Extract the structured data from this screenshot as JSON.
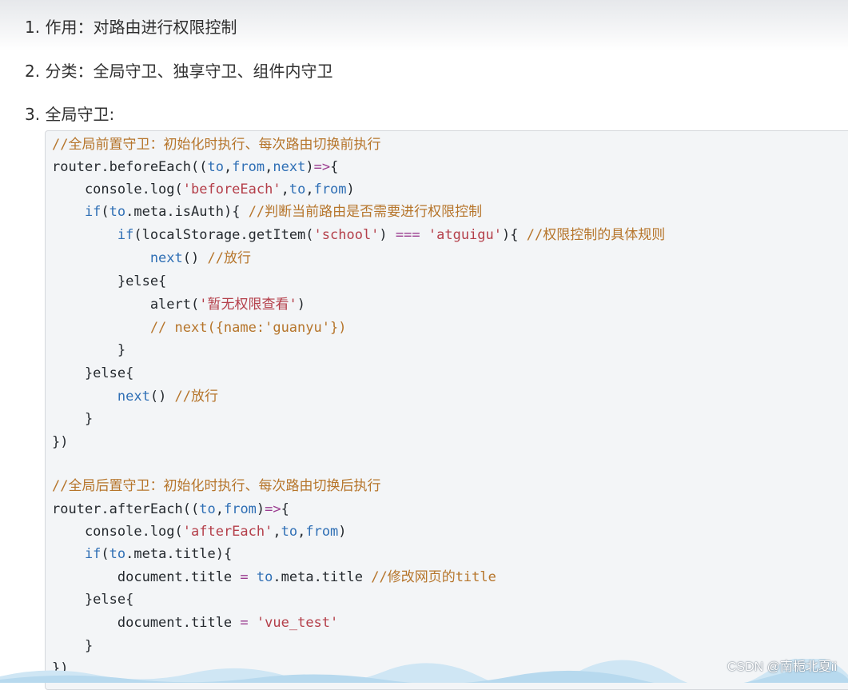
{
  "list": [
    {
      "label": "1. 作用：对路由进行权限控制"
    },
    {
      "label": "2. 分类：全局守卫、独享守卫、组件内守卫"
    },
    {
      "label": "3. 全局守卫:"
    }
  ],
  "code": [
    [
      [
        "c",
        "//全局前置守卫：初始化时执行、每次路由切换前执行"
      ]
    ],
    [
      [
        "i",
        "router.beforeEach(("
      ],
      [
        "k",
        "to"
      ],
      [
        "i",
        ","
      ],
      [
        "k",
        "from"
      ],
      [
        "i",
        ","
      ],
      [
        "k",
        "next"
      ],
      [
        "i",
        ")"
      ],
      [
        "o",
        "=>"
      ],
      [
        "i",
        "{"
      ]
    ],
    [
      [
        "i",
        "    console.log("
      ],
      [
        "s",
        "'beforeEach'"
      ],
      [
        "i",
        ","
      ],
      [
        "k",
        "to"
      ],
      [
        "i",
        ","
      ],
      [
        "k",
        "from"
      ],
      [
        "i",
        ")"
      ]
    ],
    [
      [
        "k",
        "    if"
      ],
      [
        "i",
        "("
      ],
      [
        "k",
        "to"
      ],
      [
        "i",
        ".meta.isAuth){ "
      ],
      [
        "c",
        "//判断当前路由是否需要进行权限控制"
      ]
    ],
    [
      [
        "k",
        "        if"
      ],
      [
        "i",
        "(localStorage.getItem("
      ],
      [
        "s",
        "'school'"
      ],
      [
        "i",
        ") "
      ],
      [
        "o",
        "==="
      ],
      [
        "i",
        " "
      ],
      [
        "s",
        "'atguigu'"
      ],
      [
        "i",
        "){ "
      ],
      [
        "c",
        "//权限控制的具体规则"
      ]
    ],
    [
      [
        "k",
        "            next"
      ],
      [
        "i",
        "() "
      ],
      [
        "c",
        "//放行"
      ]
    ],
    [
      [
        "i",
        "        }else{"
      ]
    ],
    [
      [
        "i",
        "            alert("
      ],
      [
        "s",
        "'暂无权限查看'"
      ],
      [
        "i",
        ")"
      ]
    ],
    [
      [
        "c",
        "            // next({name:'guanyu'})"
      ]
    ],
    [
      [
        "i",
        "        }"
      ]
    ],
    [
      [
        "i",
        "    }else{"
      ]
    ],
    [
      [
        "k",
        "        next"
      ],
      [
        "i",
        "() "
      ],
      [
        "c",
        "//放行"
      ]
    ],
    [
      [
        "i",
        "    }"
      ]
    ],
    [
      [
        "i",
        "})"
      ]
    ],
    [
      [
        "i",
        ""
      ]
    ],
    [
      [
        "c",
        "//全局后置守卫：初始化时执行、每次路由切换后执行"
      ]
    ],
    [
      [
        "i",
        "router.afterEach(("
      ],
      [
        "k",
        "to"
      ],
      [
        "i",
        ","
      ],
      [
        "k",
        "from"
      ],
      [
        "i",
        ")"
      ],
      [
        "o",
        "=>"
      ],
      [
        "i",
        "{"
      ]
    ],
    [
      [
        "i",
        "    console.log("
      ],
      [
        "s",
        "'afterEach'"
      ],
      [
        "i",
        ","
      ],
      [
        "k",
        "to"
      ],
      [
        "i",
        ","
      ],
      [
        "k",
        "from"
      ],
      [
        "i",
        ")"
      ]
    ],
    [
      [
        "k",
        "    if"
      ],
      [
        "i",
        "("
      ],
      [
        "k",
        "to"
      ],
      [
        "i",
        ".meta.title){"
      ]
    ],
    [
      [
        "i",
        "        document.title "
      ],
      [
        "o",
        "="
      ],
      [
        "i",
        " "
      ],
      [
        "k",
        "to"
      ],
      [
        "i",
        ".meta.title "
      ],
      [
        "c",
        "//修改网页的title"
      ]
    ],
    [
      [
        "i",
        "    }else{"
      ]
    ],
    [
      [
        "i",
        "        document.title "
      ],
      [
        "o",
        "="
      ],
      [
        "i",
        " "
      ],
      [
        "s",
        "'vue_test'"
      ]
    ],
    [
      [
        "i",
        "    }"
      ]
    ],
    [
      [
        "i",
        "})"
      ]
    ]
  ],
  "watermark": "CSDN @南栀北夏ii"
}
